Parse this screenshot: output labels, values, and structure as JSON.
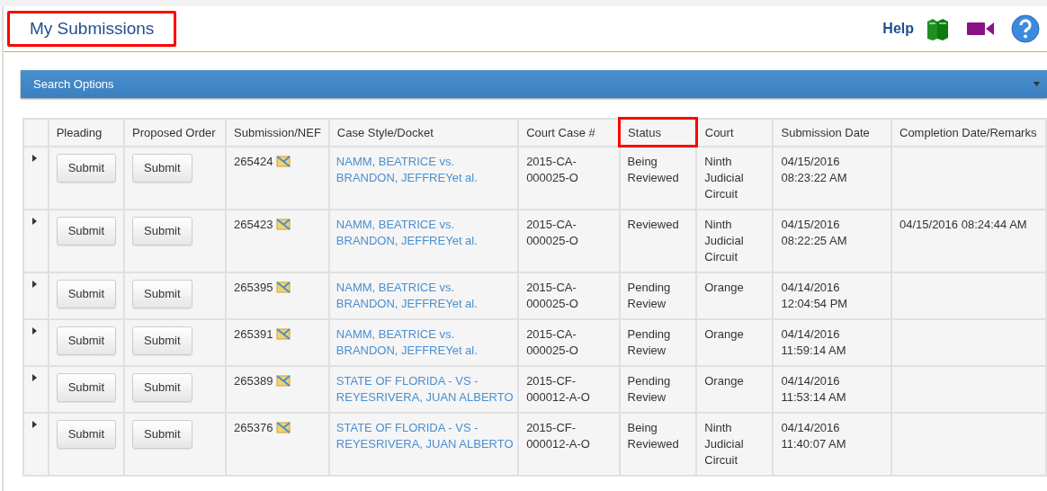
{
  "page_title": {
    "text": "My Submissions",
    "highlighted": true
  },
  "help": {
    "label": "Help"
  },
  "search_panel": {
    "title": "Search Options",
    "expanded": false
  },
  "table": {
    "columns": [
      {
        "highlighted": false
      },
      {
        "label": "Pleading",
        "highlighted": false
      },
      {
        "label": "Proposed Order",
        "highlighted": false
      },
      {
        "label": "Submission/NEF",
        "highlighted": false
      },
      {
        "label": "Case Style/Docket",
        "highlighted": false
      },
      {
        "label": "Court Case #",
        "highlighted": false
      },
      {
        "label": "Status",
        "highlighted": true
      },
      {
        "label": "Court",
        "highlighted": false
      },
      {
        "label": "Submission Date",
        "highlighted": false
      },
      {
        "label": "Completion Date/Remarks",
        "highlighted": false
      }
    ],
    "rows": [
      {
        "pleading": "Submit",
        "proposed_order": "Submit",
        "submission": "265424",
        "case_style": "NAMM, BEATRICE vs. BRANDON, JEFFREYet al.",
        "court_case": "2015-CA-000025-O",
        "status": "Being Reviewed",
        "court": "Ninth Judicial Circuit",
        "submission_date": "04/15/2016 08:23:22 AM"
      },
      {
        "pleading": "Submit",
        "proposed_order": "Submit",
        "submission": "265423",
        "case_style": "NAMM, BEATRICE vs. BRANDON, JEFFREYet al.",
        "court_case": "2015-CA-000025-O",
        "status": "Reviewed",
        "court": "Ninth Judicial Circuit",
        "submission_date": "04/15/2016 08:22:25 AM",
        "completion": "04/15/2016 08:24:44 AM"
      },
      {
        "pleading": "Submit",
        "proposed_order": "Submit",
        "submission": "265395",
        "case_style": "NAMM, BEATRICE vs. BRANDON, JEFFREYet al.",
        "court_case": "2015-CA-000025-O",
        "status": "Pending Review",
        "court": "Orange",
        "submission_date": "04/14/2016 12:04:54 PM"
      },
      {
        "pleading": "Submit",
        "proposed_order": "Submit",
        "submission": "265391",
        "case_style": "NAMM, BEATRICE vs. BRANDON, JEFFREYet al.",
        "court_case": "2015-CA-000025-O",
        "status": "Pending Review",
        "court": "Orange",
        "submission_date": "04/14/2016 11:59:14 AM"
      },
      {
        "pleading": "Submit",
        "proposed_order": "Submit",
        "submission": "265389",
        "case_style": "STATE OF FLORIDA - VS - REYESRIVERA, JUAN ALBERTO",
        "court_case": "2015-CF-000012-A-O",
        "status": "Pending Review",
        "court": "Orange",
        "submission_date": "04/14/2016 11:53:14 AM"
      },
      {
        "pleading": "Submit",
        "proposed_order": "Submit",
        "submission": "265376",
        "case_style": "STATE OF FLORIDA - VS - REYESRIVERA, JUAN ALBERTO",
        "court_case": "2015-CF-000012-A-O",
        "status": "Being Reviewed",
        "court": "Ninth Judicial Circuit",
        "submission_date": "04/14/2016 11:40:07 AM"
      }
    ]
  }
}
